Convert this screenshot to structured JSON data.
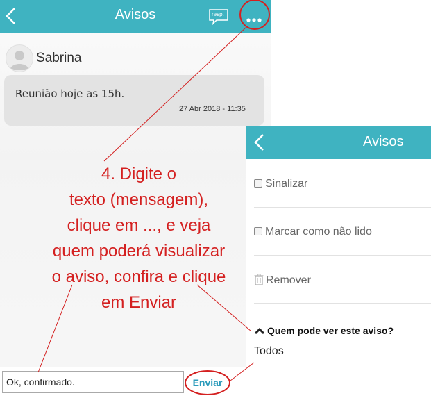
{
  "left_screen": {
    "header": {
      "title": "Avisos",
      "resp_label": "resp."
    },
    "message": {
      "sender": "Sabrina",
      "text": "Reunião hoje as 15h.",
      "timestamp": "27 Abr 2018 - 11:35"
    },
    "reply": {
      "input_value": "Ok, confirmado.",
      "send_label": "Enviar"
    }
  },
  "instruction_lines": [
    "4. Digite o",
    "texto (mensagem),",
    "clique em ..., e veja",
    "quem poderá visualizar",
    "o aviso, confira e clique",
    "em Enviar"
  ],
  "right_screen": {
    "header": {
      "title": "Avisos"
    },
    "menu": {
      "flag": "Sinalizar",
      "mark_unread": "Marcar como não lido",
      "remove": "Remover"
    },
    "visibility": {
      "heading": "Quem pode ver este aviso?",
      "value": "Todos"
    }
  },
  "colors": {
    "header": "#3fb3c1",
    "annotation": "#d42020",
    "send": "#2b9bbb"
  }
}
